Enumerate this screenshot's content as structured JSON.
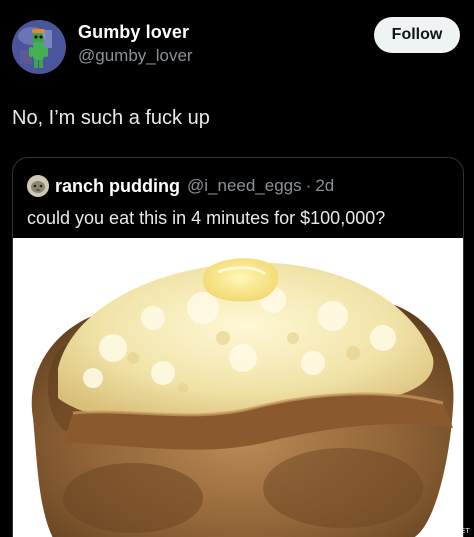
{
  "author": {
    "display_name": "Gumby lover",
    "handle": "@gumby_lover",
    "avatar_icon": "gumby-avatar-icon"
  },
  "follow_button": {
    "label": "Follow"
  },
  "tweet": {
    "text": "No, I’m such a fuck up"
  },
  "quoted_tweet": {
    "display_name": "ranch pudding",
    "handle": "@i_need_eggs",
    "separator": "·",
    "age": "2d",
    "text": "could you eat this in 4 minutes for $100,000?",
    "avatar_icon": "ranch-pudding-avatar-icon",
    "media": {
      "type": "photo",
      "icon": "baked-potato-photo"
    }
  },
  "watermark": "GAGNER.NET",
  "colors": {
    "background": "#000000",
    "primary_text": "#e7e9ea",
    "secondary_text": "#8b9199",
    "follow_button_bg": "#eff3f4",
    "follow_button_text": "#0f1419",
    "quote_border": "#2f3336"
  }
}
